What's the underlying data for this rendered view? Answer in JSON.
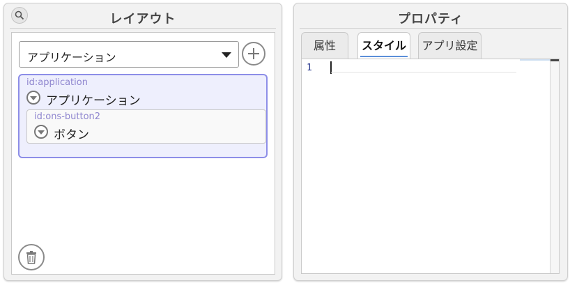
{
  "layout_panel": {
    "title": "レイアウト",
    "search_icon": "search-icon",
    "page_select": {
      "value": "アプリケーション"
    },
    "add_icon": "plus-circle-icon",
    "tree": {
      "application": {
        "id_label": "id:application",
        "label": "アプリケーション",
        "toggle_icon": "chevron-down-circle-icon"
      },
      "button": {
        "id_label": "id:ons-button2",
        "label": "ボタン",
        "toggle_icon": "chevron-down-circle-icon"
      }
    },
    "delete_icon": "trash-icon"
  },
  "properties_panel": {
    "title": "プロパティ",
    "tabs": [
      {
        "label": "属性",
        "active": false
      },
      {
        "label": "スタイル",
        "active": true
      },
      {
        "label": "アプリ設定",
        "active": false
      }
    ],
    "editor": {
      "line_numbers": [
        "1"
      ],
      "content": ""
    }
  },
  "colors": {
    "selection_border": "#8d8ee8",
    "selection_bg": "#eeeffd",
    "id_text": "#8f86cf",
    "active_tab_underline": "#5b8fd9"
  }
}
